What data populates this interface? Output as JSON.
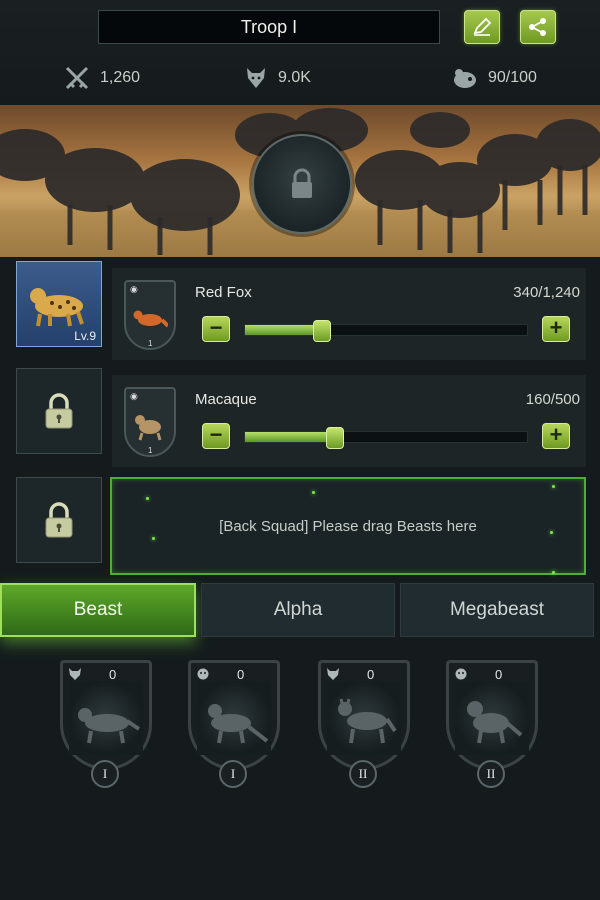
{
  "header": {
    "troop_name": "Troop I",
    "edit_icon": "edit-icon",
    "share_icon": "share-icon"
  },
  "stats": {
    "power": "1,260",
    "wolf_value": "9.0K",
    "capacity": "90/100"
  },
  "banner": {
    "lock_icon": "lock-icon"
  },
  "squad": {
    "leader": {
      "level": "Lv.9"
    },
    "rows": [
      {
        "name": "Red Fox",
        "count": "340/1,240",
        "fill_fraction": 0.274
      },
      {
        "name": "Macaque",
        "count": "160/500",
        "fill_fraction": 0.32
      }
    ],
    "back_squad_text": "[Back Squad] Please drag Beasts here",
    "minus_label": "−",
    "plus_label": "+"
  },
  "tabs": [
    "Beast",
    "Alpha",
    "Megabeast"
  ],
  "active_tab": "Beast",
  "cards": [
    {
      "count": "0",
      "tier": "I",
      "category": "wolf"
    },
    {
      "count": "0",
      "tier": "I",
      "category": "primate"
    },
    {
      "count": "0",
      "tier": "II",
      "category": "wolf"
    },
    {
      "count": "0",
      "tier": "II",
      "category": "primate"
    }
  ],
  "colors": {
    "accent_green": "#5ea82a",
    "background": "#151b1d"
  }
}
